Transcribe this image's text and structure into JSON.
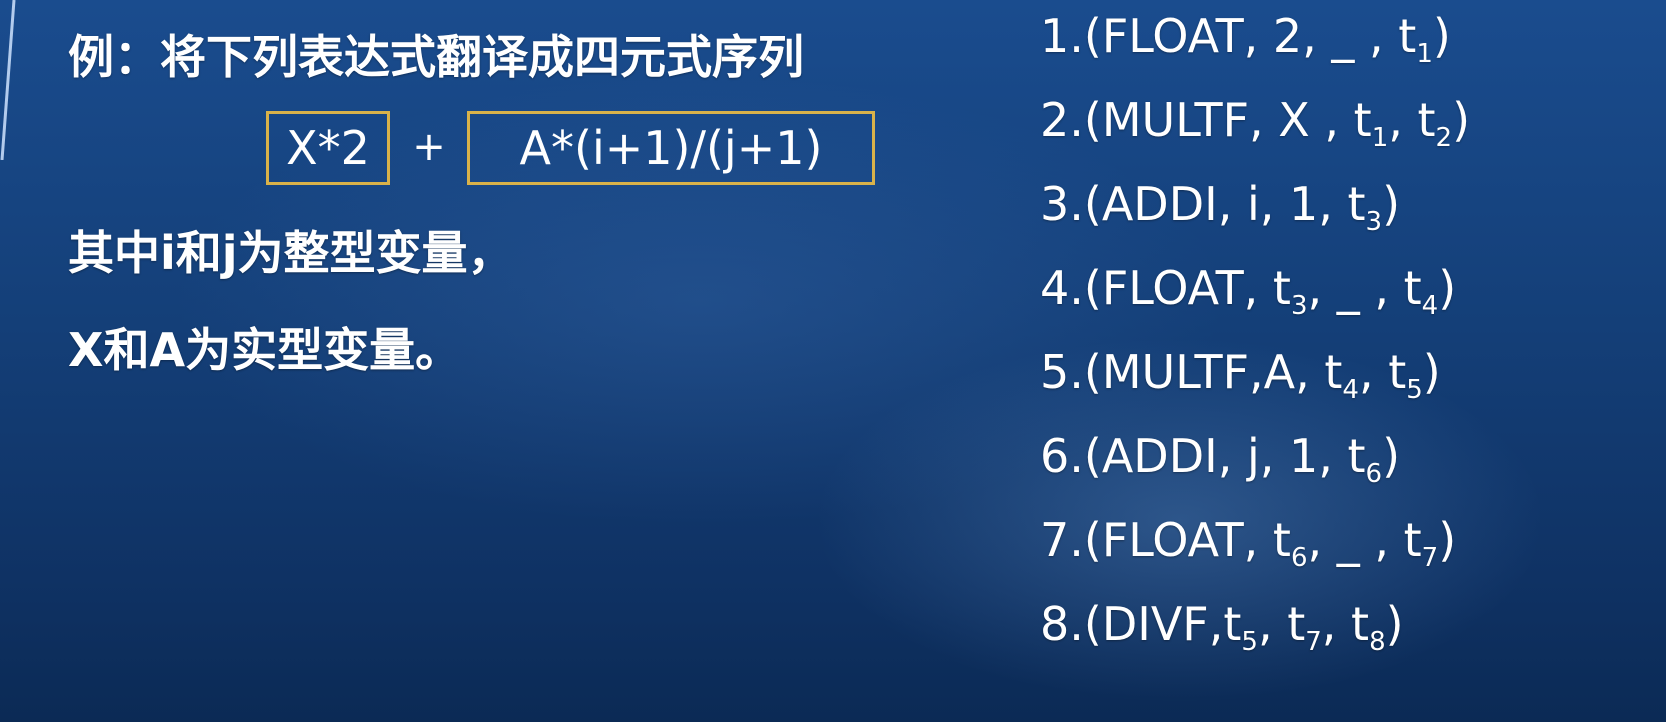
{
  "intro": {
    "title": "例：将下列表达式翻译成四元式序列",
    "expr_part1": "X*2",
    "expr_plus": "+",
    "expr_part2": "A*(i+1)/(j+1)",
    "note_line1": "其中i和j为整型变量，",
    "note_line2": "X和A为实型变量。"
  },
  "quadruples": [
    {
      "prefix": "1.(FLOAT, 2, _ , t",
      "sub1": "1",
      "mid": ")",
      "sub2": "",
      "end": ""
    },
    {
      "prefix": "2.(MULTF, X , t",
      "sub1": "1",
      "mid": ", t",
      "sub2": "2",
      "end": ")"
    },
    {
      "prefix": "3.(ADDI, i, 1, t",
      "sub1": "3",
      "mid": ")",
      "sub2": "",
      "end": ""
    },
    {
      "prefix": "4.(FLOAT, t",
      "sub1": "3",
      "mid": ", _ , t",
      "sub2": "4",
      "end": ")"
    },
    {
      "prefix": "5.(MULTF,A, t",
      "sub1": "4",
      "mid": ", t",
      "sub2": "5",
      "end": ")"
    },
    {
      "prefix": "6.(ADDI, j, 1, t",
      "sub1": "6",
      "mid": ")",
      "sub2": "",
      "end": ""
    },
    {
      "prefix": "7.(FLOAT, t",
      "sub1": "6",
      "mid": ", _ , t",
      "sub2": "7",
      "end": ")"
    },
    {
      "prefix": "8.(DIVF,t",
      "sub1": "5",
      "mid": ", t",
      "sub2": "7",
      "end": ", t",
      "sub3": "8",
      "tail": ")"
    }
  ],
  "colors": {
    "box_border": "#d9b24a",
    "background_top": "#1a4c8e",
    "background_bottom": "#0b2a55"
  }
}
